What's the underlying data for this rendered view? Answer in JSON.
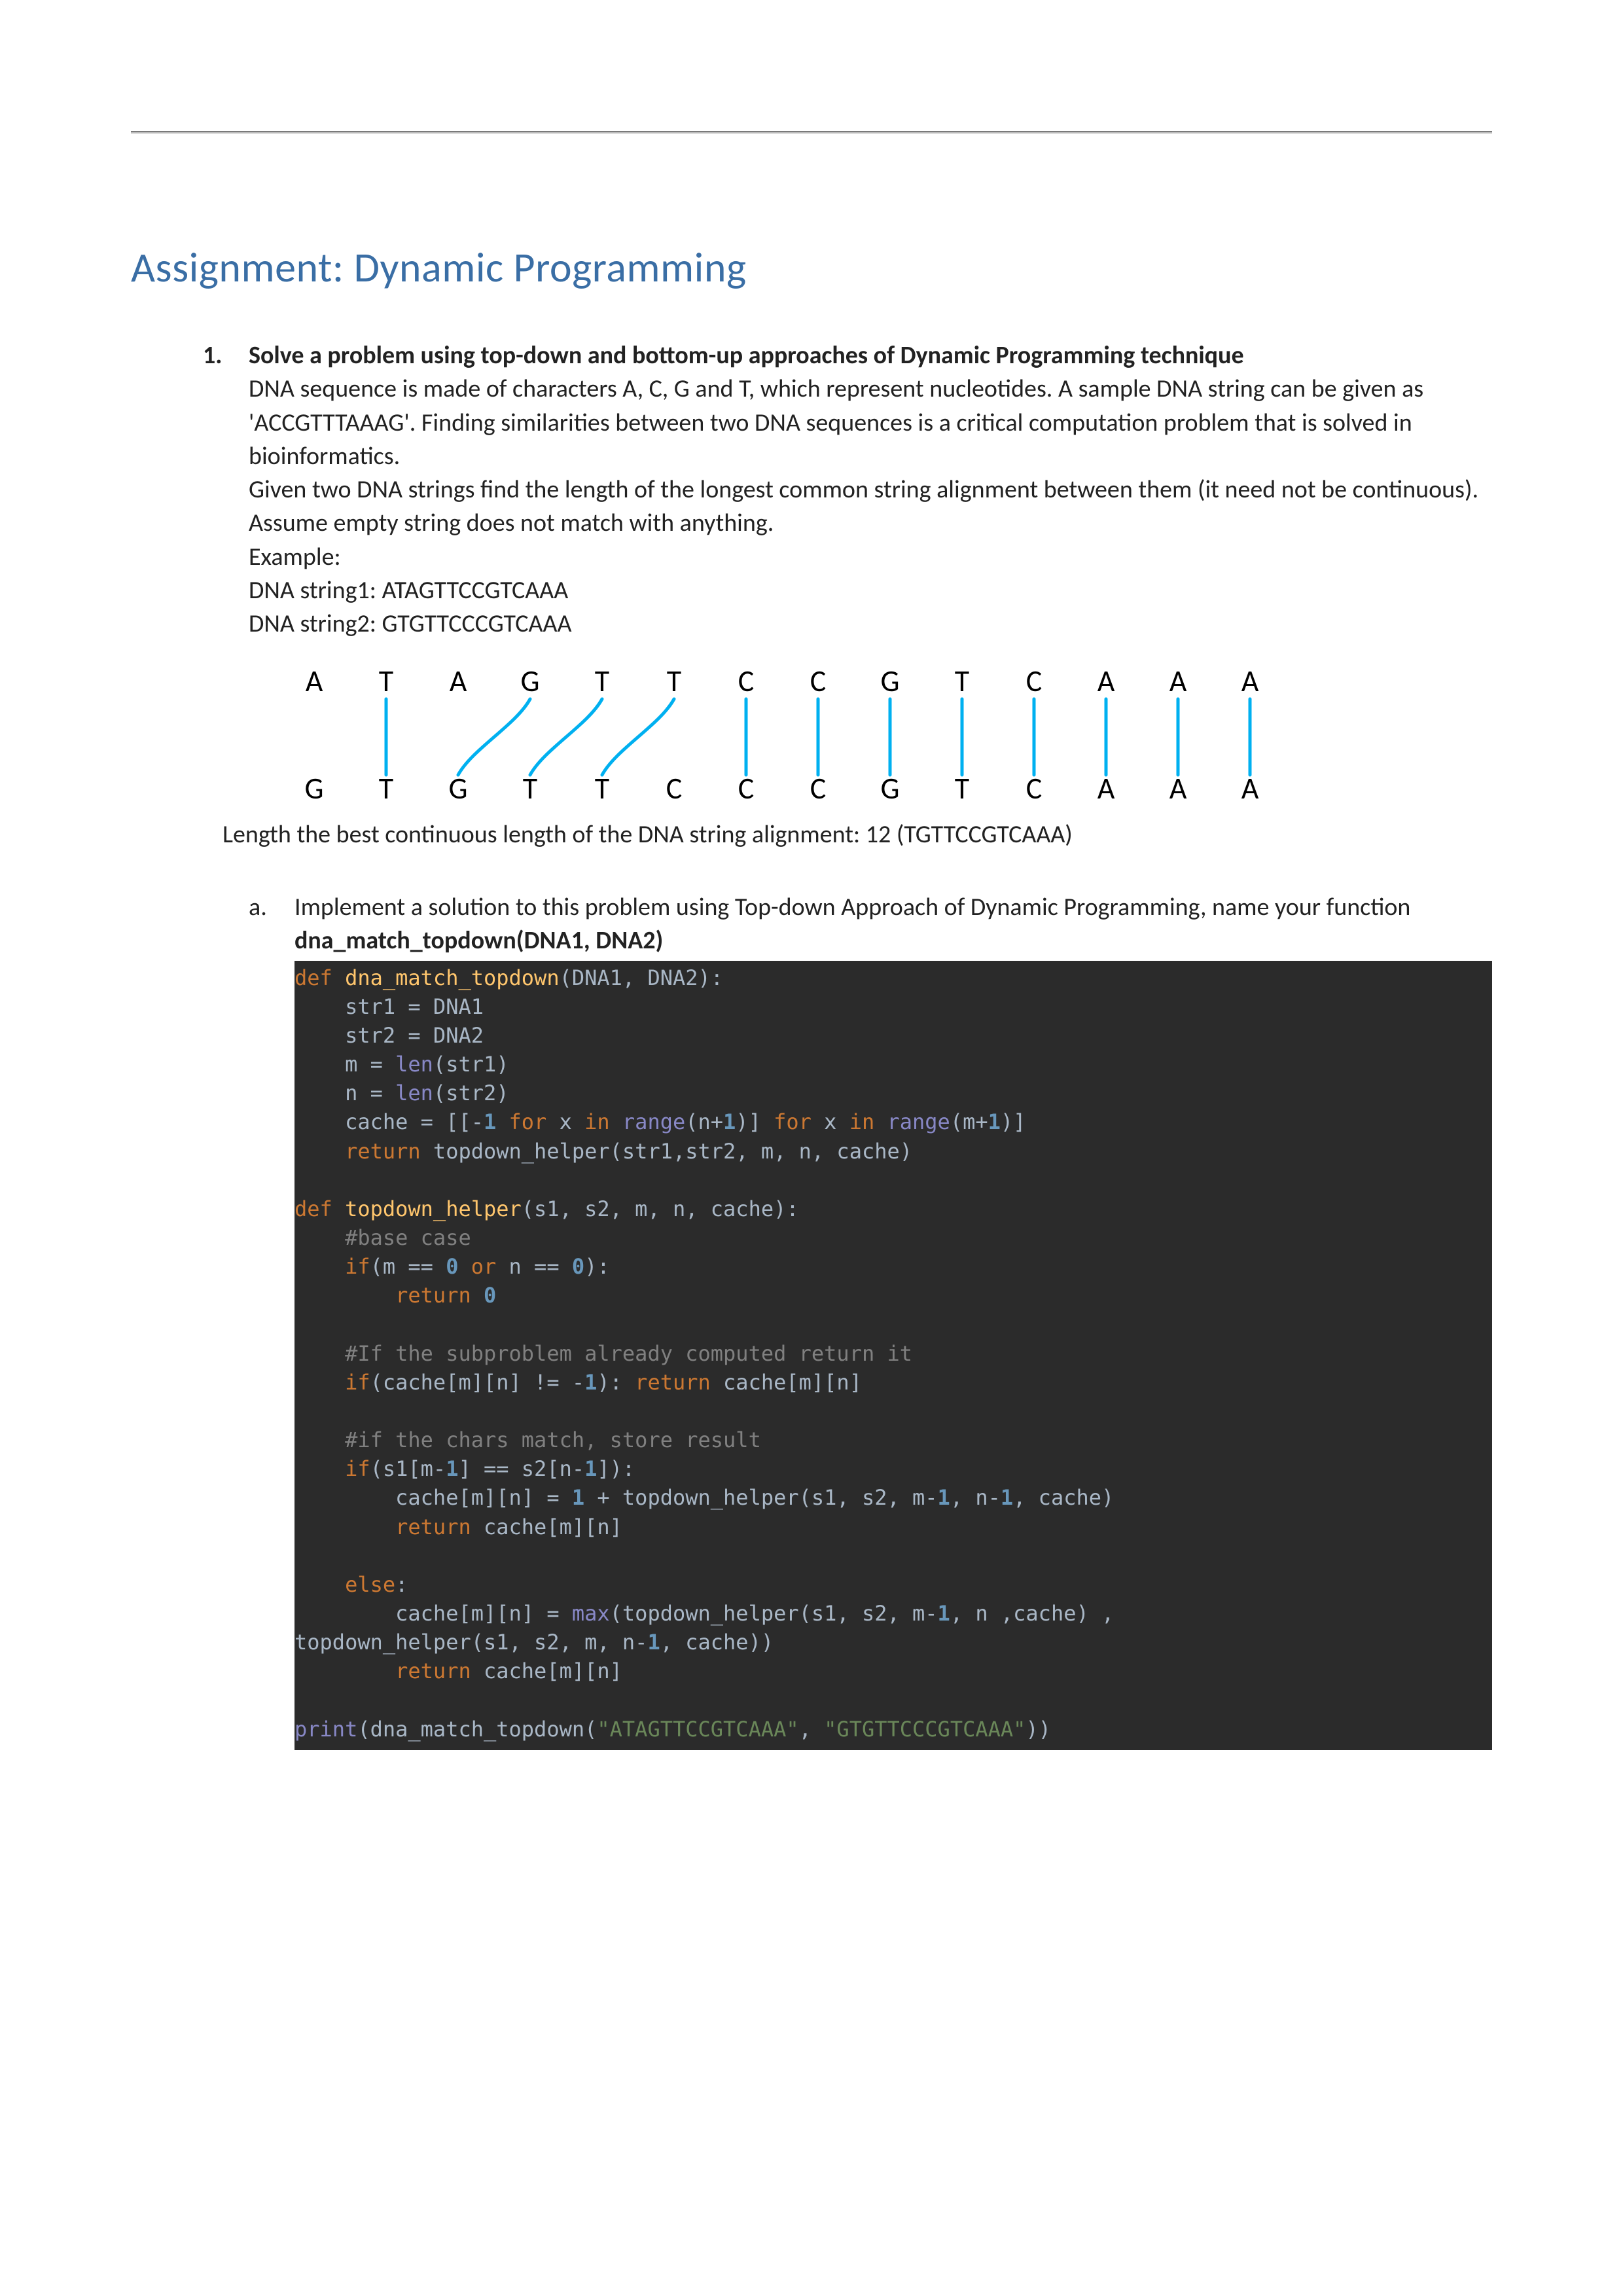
{
  "title": "Assignment: Dynamic Programming",
  "question": {
    "number": "1.",
    "heading": "Solve a problem using top-down and bottom-up approaches of Dynamic Programming technique",
    "para1": "DNA sequence is made of characters A, C, G and T, which represent nucleotides. A sample DNA string can be given as 'ACCGTTTAAAG'. Finding similarities between two DNA sequences is a critical computation problem that is solved in bioinformatics.",
    "para2": "Given two DNA strings find the length of the longest common string alignment between them (it need not be continuous). Assume empty string does not match with anything.",
    "example_label": "Example:",
    "dna1_label": "DNA string1: ATAGTTCCGTCAAA",
    "dna2_label": "DNA string2: GTGTTCCCGTCAAA",
    "dna_row1": [
      "A",
      "T",
      "A",
      "G",
      "T",
      "T",
      "C",
      "C",
      "G",
      "T",
      "C",
      "A",
      "A",
      "A"
    ],
    "dna_row2": [
      "G",
      "T",
      "G",
      "T",
      "T",
      "C",
      "C",
      "C",
      "G",
      "T",
      "C",
      "A",
      "A",
      "A"
    ],
    "length_line": "Length the best continuous length of the DNA string alignment: 12 (TGTTCCGTCAAA)"
  },
  "sub_a": {
    "label": "a.",
    "text_prefix": "Implement a solution to this problem using Top-down Approach of Dynamic Programming, name your function ",
    "fn_name": "dna_match_topdown(DNA1, DNA2)"
  },
  "code": {
    "l01_def": "def ",
    "l01_fn": "dna_match_topdown",
    "l01_rest": "(DNA1, DNA2):",
    "l02": "    str1 = DNA1",
    "l03": "    str2 = DNA2",
    "l04a": "    m = ",
    "l04b": "len",
    "l04c": "(str1)",
    "l05a": "    n = ",
    "l05b": "len",
    "l05c": "(str2)",
    "l06a": "    cache = [[-",
    "l06n1": "1",
    "l06b": " ",
    "l06for1": "for",
    "l06c": " x ",
    "l06in1": "in",
    "l06d": " ",
    "l06rng1": "range",
    "l06e": "(n+",
    "l06n2": "1",
    "l06f": ")] ",
    "l06for2": "for",
    "l06g": " x ",
    "l06in2": "in",
    "l06h": " ",
    "l06rng2": "range",
    "l06i": "(m+",
    "l06n3": "1",
    "l06j": ")]",
    "l07a": "    ",
    "l07ret": "return",
    "l07b": " topdown_helper(str1,str2, m, n, cache)",
    "blank1": "",
    "l09_def": "def ",
    "l09_fn": "topdown_helper",
    "l09_rest": "(s1, s2, m, n, cache):",
    "l10": "    #base case",
    "l11a": "    ",
    "l11if": "if",
    "l11b": "(m == ",
    "l11n0a": "0",
    "l11c": " ",
    "l11or": "or",
    "l11d": " n == ",
    "l11n0b": "0",
    "l11e": "):",
    "l12a": "        ",
    "l12ret": "return ",
    "l12n": "0",
    "blank2": "",
    "l14": "    #If the subproblem already computed return it",
    "l15a": "    ",
    "l15if": "if",
    "l15b": "(cache[m][n] != -",
    "l15n": "1",
    "l15c": "): ",
    "l15ret": "return",
    "l15d": " cache[m][n]",
    "blank3": "",
    "l17": "    #if the chars match, store result",
    "l18a": "    ",
    "l18if": "if",
    "l18b": "(s1[m-",
    "l18n1": "1",
    "l18c": "] == s2[n-",
    "l18n2": "1",
    "l18d": "]):",
    "l19a": "        cache[m][n] = ",
    "l19n1": "1",
    "l19b": " + topdown_helper(s1, s2, m-",
    "l19n2": "1",
    "l19c": ", n-",
    "l19n3": "1",
    "l19d": ", cache)",
    "l20a": "        ",
    "l20ret": "return",
    "l20b": " cache[m][n]",
    "blank4": "",
    "l22a": "    ",
    "l22else": "else",
    "l22b": ":",
    "l23a": "        cache[m][n] = ",
    "l23max": "max",
    "l23b": "(topdown_helper(s1, s2, m-",
    "l23n1": "1",
    "l23c": ", n ,cache) ,",
    "l24a": "topdown_helper(s1, s2, m, n-",
    "l24n": "1",
    "l24b": ", cache))",
    "l25a": "        ",
    "l25ret": "return",
    "l25b": " cache[m][n]",
    "blank5": "",
    "l27a": "print",
    "l27b": "(dna_match_topdown(",
    "l27s1": "\"ATAGTTCCGTCAAA\"",
    "l27c": ", ",
    "l27s2": "\"GTGTTCCCGTCAAA\"",
    "l27d": "))"
  }
}
